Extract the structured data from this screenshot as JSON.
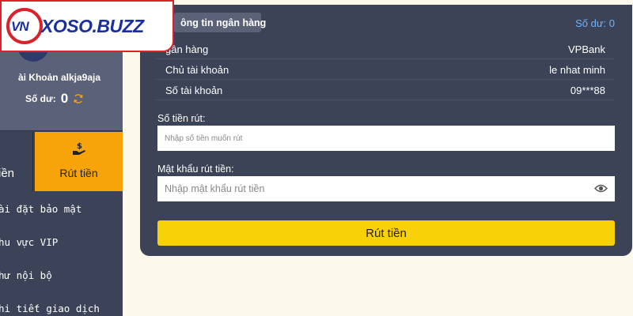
{
  "logo": {
    "emblem_text": "VN",
    "wordmark": "XOSO.BUZZ"
  },
  "sidebar": {
    "account_label": "ài Khoản alkja9aja",
    "balance_label": "Số dư:",
    "balance_value": "0",
    "tiles": {
      "left_label": "iền",
      "withdraw_label": "Rút tiền"
    },
    "menu": [
      {
        "label": "ài đặt bảo mật"
      },
      {
        "label": "hu vực VIP"
      },
      {
        "label": "hư nội bộ"
      },
      {
        "label": "hi tiết giao dịch"
      }
    ]
  },
  "panel": {
    "bank_tab_label": "ông tin ngân hàng",
    "balance_text": "Số dư: 0",
    "bank_info": [
      {
        "key": "gân hàng",
        "value": "VPBank"
      },
      {
        "key": "Chủ tài khoản",
        "value": "le nhat minh"
      },
      {
        "key": "Số tài khoản",
        "value": "09***88"
      }
    ],
    "amount_label": "Số tiền rút:",
    "amount_placeholder": "Nhập số tiền muốn rút",
    "password_label": "Mật khẩu rút tiền:",
    "password_placeholder": "Nhập mật khẩu rút tiền",
    "submit_label": "Rút tiền"
  },
  "colors": {
    "accent_yellow": "#f8d109",
    "tile_orange": "#f6a40a",
    "panel_bg": "#3c4356",
    "balance_blue": "#6fb3ff",
    "logo_red": "#d9222a",
    "logo_blue": "#1a2fa0"
  },
  "icons": [
    "avatar",
    "refresh-icon",
    "money-hand-icon",
    "eye-icon"
  ]
}
